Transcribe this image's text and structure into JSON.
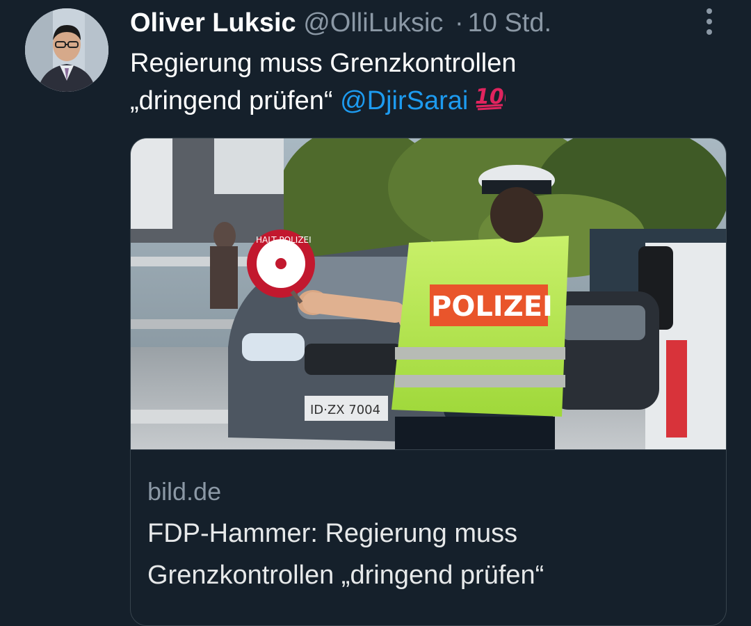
{
  "tweet": {
    "author_name": "Oliver Luksic",
    "author_handle": "@OlliLuksic",
    "separator": "·",
    "timestamp": "10 Std.",
    "text_line1": "Regierung muss Grenzkontrollen",
    "text_line2": "„dringend prüfen“",
    "mention": "@DjirSarai",
    "emoji": "hundred-points-emoji"
  },
  "card": {
    "domain": "bild.de",
    "title": "FDP-Hammer: Regierung muss Grenzkontrollen „dringend prüfen“",
    "image": {
      "vest_text": "POLIZEI",
      "plate_text": "ID·ZX 7004",
      "paddle_text": "HALT POLIZEI"
    }
  },
  "icons": {
    "more": "more-vertical-icon"
  },
  "colors": {
    "background": "#15202b",
    "text": "#ffffff",
    "muted": "#8b98a5",
    "link": "#1d9bf0",
    "border": "#38444d",
    "emoji_red": "#e0245e"
  }
}
